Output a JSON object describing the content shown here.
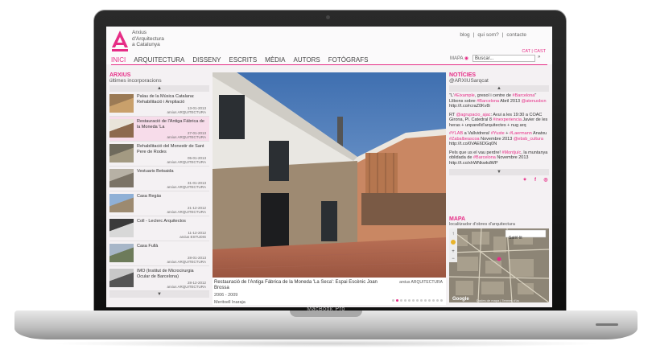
{
  "device": {
    "brand": "MacBook Pro"
  },
  "site": {
    "logo_lines": [
      "Arxius",
      "d'Arquitectura",
      "a Catalunya"
    ],
    "top_links": [
      "blog",
      "|",
      "qui som?",
      "|",
      "contacte"
    ],
    "languages": "CAT | CAST",
    "nav": [
      "INICI",
      "ARQUITECTURA",
      "DISSENY",
      "ESCRITS",
      "MÈDIA",
      "AUTORS",
      "FOTÒGRAFS"
    ],
    "map_label": "MAPA",
    "search_placeholder": "Buscar...",
    "search_go": "»"
  },
  "left": {
    "title": "ARXIUS",
    "subtitle": "últimes incorporacions",
    "items": [
      {
        "title": "Palau de la Música Catalana: Rehabilitació i Ampliació",
        "date": "13-01-2013",
        "cat": "arxius ARQUITECTURA"
      },
      {
        "title": "Restauració de l'Antiga Fàbrica de la Moneda 'La",
        "date": "27-01-2013",
        "cat": "arxius ARQUITECTURA"
      },
      {
        "title": "Rehabilitació del Monestir de Sant Pere de Rodes",
        "date": "05-01-2013",
        "cat": "arxius ARQUITECTURA"
      },
      {
        "title": "Vestuaris Betsaida",
        "date": "31-01-2013",
        "cat": "arxius ARQUITECTURA"
      },
      {
        "title": "Casa Regàs",
        "date": "21-12-2012",
        "cat": "arxius ARQUITECTURA"
      },
      {
        "title": "Coll - Leclerc Arquitectos",
        "date": "11-12-2012",
        "cat": "arxius ESTUDIS"
      },
      {
        "title": "Casa Fullà",
        "date": "28-01-2013",
        "cat": "arxius ARQUITECTURA"
      },
      {
        "title": "IMO (Institut de Microcirurgia Ocular de Barcelona)",
        "date": "28-12-2012",
        "cat": "arxius ARQUITECTURA"
      }
    ]
  },
  "main": {
    "caption": "Restauració de l'Antiga Fàbrica de la Moneda 'La Seca': Espai Escènic Joan Brossa",
    "category": "arxius ARQUITECTURA",
    "years": "2006 - 2009",
    "photographer": "Meritxell Inaraja",
    "slides": 13,
    "active_slide": 1
  },
  "right": {
    "title": "NOTÍCIES",
    "handle": "@ARXIUSarqcat",
    "tweets": [
      {
        "parts": [
          "\"L'",
          "#Eixample",
          ", gresol i centre de ",
          "#Barcelona",
          "\" Llibons sobre ",
          "#Barcelona",
          " Abril 2013 ",
          "@atenusbcn",
          " http://t.co/rcraZ0Kv8i"
        ]
      },
      {
        "parts": [
          "RT ",
          "@agrupacio_ajac",
          ": Avui a les 19:30 a COAC Girona, Pl. Catedral 8 ",
          "#inexperiencia",
          " Javier de les heras + unparelld'arquitectes + nug arq"
        ]
      },
      {
        "parts": [
          "",
          "#YLAB",
          " a Vallvidrera! ",
          "#Yuste",
          " + ",
          "#Laermann",
          " Anatxu ",
          "#Zabalbeascoa",
          " Novembre 2013 ",
          "@ebsb_cultura",
          " http://t.co/0VAE6DGq0N"
        ]
      },
      {
        "parts": [
          "Pels que us el vau perdre! ",
          "#Montjuïc",
          ", la muntanya oblidada de ",
          "#Barcelona",
          " Novembre 2013 http://t.co/xhWNkwkdWP"
        ]
      }
    ],
    "map_title": "MAPA",
    "map_subtitle": "localitzador d'obres d'arquitectura",
    "map_type": "Satèl·lit",
    "map_footer": "Google",
    "map_terms": "Dades de mapa | Termes d'ús"
  },
  "colors": {
    "accent": "#e62d86"
  }
}
